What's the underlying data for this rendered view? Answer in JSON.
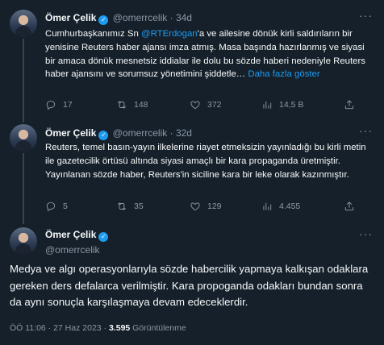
{
  "tweets": [
    {
      "name": "Ömer Çelik",
      "handle": "@omerrcelik",
      "separator": "·",
      "time": "34d",
      "text_parts": [
        "Cumhurbaşkanımız Sn ",
        "@RTErdogan",
        "'a ve ailesine dönük kirli saldırıların bir yenisine Reuters haber ajansı imza atmış. Masa başında hazırlanmış ve siyasi bir amaca dönük mesnetsiz iddialar ile dolu bu sözde haberi nedeniyle Reuters haber ajansını ve sorumsuz yönetimini şiddetle… ",
        "Daha fazla göster"
      ],
      "replies": "17",
      "retweets": "148",
      "likes": "372",
      "views": "14,5 B"
    },
    {
      "name": "Ömer Çelik",
      "handle": "@omerrcelik",
      "separator": "·",
      "time": "32d",
      "text": "Reuters, temel basın-yayın ilkelerine riayet etmeksizin yayınladığı bu kirli metin ile gazetecilik örtüsü altında siyasi amaçlı bir kara propaganda üretmiştir. Yayınlanan sözde haber, Reuters'in siciline kara bir leke olarak kazınmıştır.",
      "replies": "5",
      "retweets": "35",
      "likes": "129",
      "views": "4.455"
    }
  ],
  "main": {
    "name": "Ömer Çelik",
    "handle": "@omerrcelik",
    "text": "Medya ve algı operasyonlarıyla sözde habercilik yapmaya kalkışan odaklara gereken ders defalarca verilmiştir. Kara propoganda odakları bundan sonra da aynı sonuçla karşılaşmaya devam edeceklerdir.",
    "timestamp": "ÖÖ 11:06 · 27 Haz 2023 · ",
    "views_count": "3.595",
    "views_label": " Görüntülenme"
  },
  "icons": {
    "reply": "reply-icon",
    "retweet": "retweet-icon",
    "like": "heart-icon",
    "views": "views-chart-icon",
    "share": "share-icon",
    "more": "more-icon",
    "verified": "verified-icon"
  },
  "colors": {
    "background": "#15202b",
    "text": "#f7f9f9",
    "secondary": "#8b98a5",
    "accent": "#1d9bf0"
  }
}
